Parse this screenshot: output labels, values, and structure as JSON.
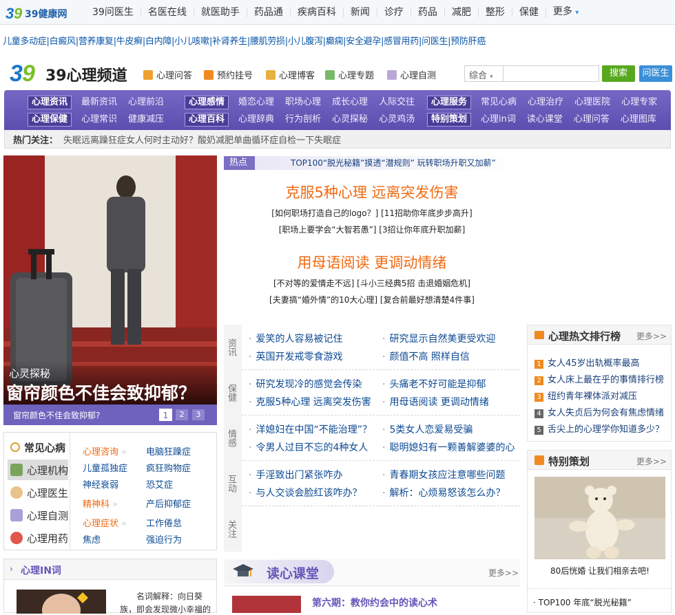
{
  "topnav": {
    "logo": "39健康网",
    "items": [
      "39问医生",
      "名医在线",
      "就医助手",
      "药品通",
      "疾病百科",
      "新闻",
      "诊疗",
      "药品",
      "减肥",
      "整形",
      "保健",
      "更多"
    ]
  },
  "quicklinks": [
    "儿童多动症",
    "白癜风",
    "营养康复",
    "牛皮癣",
    "白内障",
    "小儿咳嗽",
    "补肾养生",
    "腰肌劳损",
    "小儿腹泻",
    "癫痫",
    "安全避孕",
    "感冒用药",
    "问医生",
    "预防肝癌"
  ],
  "channel": {
    "logo": "39心理频道",
    "nav": [
      "心理问答",
      "预约挂号",
      "心理博客",
      "心理专题",
      "心理自测"
    ],
    "search_select": "综合",
    "search_placeholder": "",
    "search_button": "搜索",
    "ask_button": "问医生"
  },
  "menu": {
    "row1": [
      {
        "tag": "心理资讯",
        "items": [
          "最新资讯",
          "心理前沿"
        ]
      },
      {
        "tag": "心理感情",
        "items": [
          "婚恋心理",
          "职场心理",
          "成长心理",
          "人际交往"
        ]
      },
      {
        "tag": "心理服务",
        "items": [
          "常见心病",
          "心理治疗",
          "心理医院",
          "心理专家"
        ]
      }
    ],
    "row2": [
      {
        "tag": "心理保健",
        "items": [
          "心理常识",
          "健康减压"
        ]
      },
      {
        "tag": "心理百科",
        "items": [
          "心理辞典",
          "行为剖析",
          "心灵探秘",
          "心灵鸡汤"
        ]
      },
      {
        "tag": "特别策划",
        "items": [
          "心理in词",
          "读心课堂",
          "心理问答",
          "心理图库"
        ]
      }
    ]
  },
  "hot_keywords": {
    "label": "热门关注：",
    "items": [
      "失眠",
      "远离躁狂症",
      "女人何时主动好？",
      "酸奶减肥",
      "单曲循环症",
      "自检一下失眠症"
    ]
  },
  "hero": {
    "tag": "心灵探秘",
    "headline": "窗帘颜色不佳会致抑郁？",
    "caption": "窗帘颜色不佳会致抑郁?",
    "pages": [
      "1",
      "2",
      "3"
    ]
  },
  "hot": {
    "label": "热点",
    "ticker": "TOP100“脱光秘籍”摸透“潜规则” 玩转职场升职又加薪”",
    "headline1": "克服5种心理 远离突发伤害",
    "lines1": [
      "[如何职场打造自己的logo？] [11招助你年底步步高升]",
      "[职场上要学会“大智若愚”] [3招让你年底升职加薪]"
    ],
    "headline2": "用母语阅读 更调动情绪",
    "lines2": [
      "[不对等的爱情走不远] [斗小三经典5招 击退婚姻危机]",
      "[夫妻搞“婚外情”的10大心理] [复合前最好想清楚4件事]"
    ]
  },
  "news": [
    {
      "label": "资讯",
      "items": [
        "爱笑的人容易被记住",
        "研究显示自然美更受欢迎",
        "英国开发戒零食游戏",
        "颜值不高 照样自信"
      ]
    },
    {
      "label": "保健",
      "items": [
        "研究发现冷的感觉会传染",
        "头痛老不好可能是抑郁",
        "克服5种心理 远离突发伤害",
        "用母语阅读 更调动情绪"
      ]
    },
    {
      "label": "情感",
      "items": [
        "洋媳妇在中国“不能治理”？",
        "5类女人恋爱易受骗",
        "令男人过目不忘的4种女人",
        "聪明媳妇有一颗善解婆婆的心"
      ]
    },
    {
      "label": "互动",
      "items": [
        "手淫致出门紧张咋办",
        "青春期女孩应注意哪些问题",
        "与人交谈会脸红该咋办？",
        "解析：心烦易怒该怎么办？"
      ]
    },
    {
      "label": "关注",
      "items": []
    }
  ],
  "rank": {
    "title": "心理热文排行榜",
    "more": "更多>>",
    "items": [
      "女人45岁出轨概率最高",
      "女人床上最在乎的事情排行榜",
      "纽约青年裸体派对减压",
      "女人失贞后为何会有焦虑情绪",
      "舌尖上的心理学你知道多少？"
    ]
  },
  "special": {
    "title": "特别策划",
    "more": "更多>>",
    "caption": "80后恍婚 让我们相亲去吧!",
    "link": "· TOP100 年底“脱光秘籍”"
  },
  "categories": {
    "tabs": [
      "常见心病",
      "心理机构",
      "心理医生",
      "心理自测",
      "心理用药"
    ],
    "links": [
      [
        "心理咨询",
        "电脑狂躁症"
      ],
      [
        "儿童孤独症",
        "疯狂购物症"
      ],
      [
        "神经衰弱",
        "恐艾症"
      ],
      [
        "精神科",
        "产后抑郁症"
      ],
      [
        "心理症状",
        "工作倦怠"
      ],
      [
        "焦虑",
        "强迫行为"
      ]
    ]
  },
  "inword": {
    "title": "心理IN词",
    "text1": "名词解释：向日葵",
    "text2": "族，即会发现微小幸福的"
  },
  "classroom": {
    "title": "读心课堂",
    "more": "更多>>",
    "item": "第六期：教你约会中的读心术"
  },
  "colors": {
    "accent": "#ef6a12",
    "menu": "#6557b9",
    "link": "#0c4a93",
    "green": "#57a81f",
    "blue": "#3b8ed8"
  }
}
